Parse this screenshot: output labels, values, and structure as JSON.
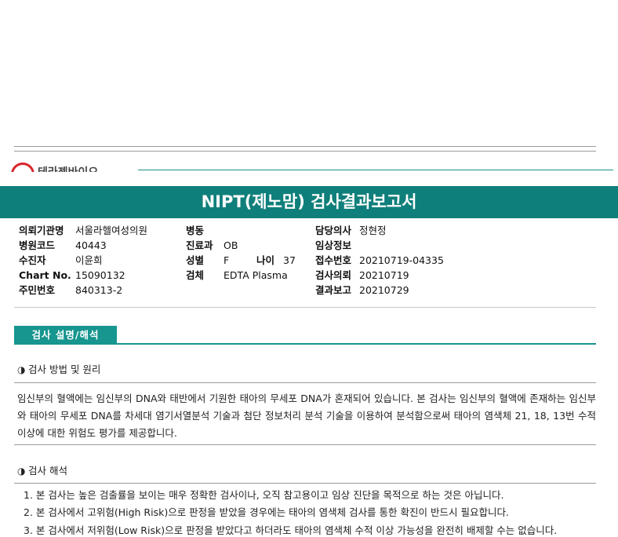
{
  "header": {
    "logo_text": "테라젠바이오",
    "title": "NIPT(제노맘) 검사결과보고서"
  },
  "info": {
    "col1": [
      {
        "label": "의뢰기관명",
        "value": "서울라헬여성의원"
      },
      {
        "label": "병원코드",
        "value": "40443"
      },
      {
        "label": "수진자",
        "value": "이윤희"
      },
      {
        "label": "Chart No.",
        "value": "15090132"
      },
      {
        "label": "주민번호",
        "value": "840313-2"
      }
    ],
    "col2": {
      "ward_label": "병동",
      "ward_value": "",
      "dept_label": "진료과",
      "dept_value": "OB",
      "sex_label": "성별",
      "sex_value": "F",
      "age_label": "나이",
      "age_value": "37",
      "specimen_label": "검체",
      "specimen_value": "EDTA Plasma"
    },
    "col3": [
      {
        "label": "담당의사",
        "value": "정현정"
      },
      {
        "label": "임상정보",
        "value": ""
      },
      {
        "label": "접수번호",
        "value": "20210719-04335"
      },
      {
        "label": "검사의뢰",
        "value": "20210719"
      },
      {
        "label": "결과보고",
        "value": "20210729"
      }
    ]
  },
  "section": {
    "tab": "검사 설명/해석",
    "method_title": "검사 방법 및 원리",
    "method_para": "임신부의 혈액에는 임신부의 DNA와 태반에서 기원한 태아의 무세포 DNA가 혼재되어 있습니다. 본 검사는 임신부의 혈액에 존재하는 임신부와 태아의 무세포 DNA를 차세대 염기서열분석 기술과 첨단 정보처리 분석 기술을 이용하여 분석함으로써 태아의 염색체 21, 18, 13번 수적 이상에 대한 위험도 평가를 제공합니다.",
    "interp_title": "검사 해석",
    "items": [
      "1. 본 검사는 높은 검출률을 보이는 매우 정확한 검사이나, 오직 참고용이고 임상 진단을 목적으로 하는 것은 아닙니다.",
      "2. 본 검사에서 고위험(High Risk)으로 판정을 받았을 경우에는 태아의 염색체 검사를 통한 확진이 반드시 필요합니다.",
      "3. 본 검사에서 저위험(Low Risk)으로 판정을 받았다고 하더라도 태아의 염색체 수적 이상 가능성을 완전히 배제할 수는 없습니다."
    ]
  }
}
